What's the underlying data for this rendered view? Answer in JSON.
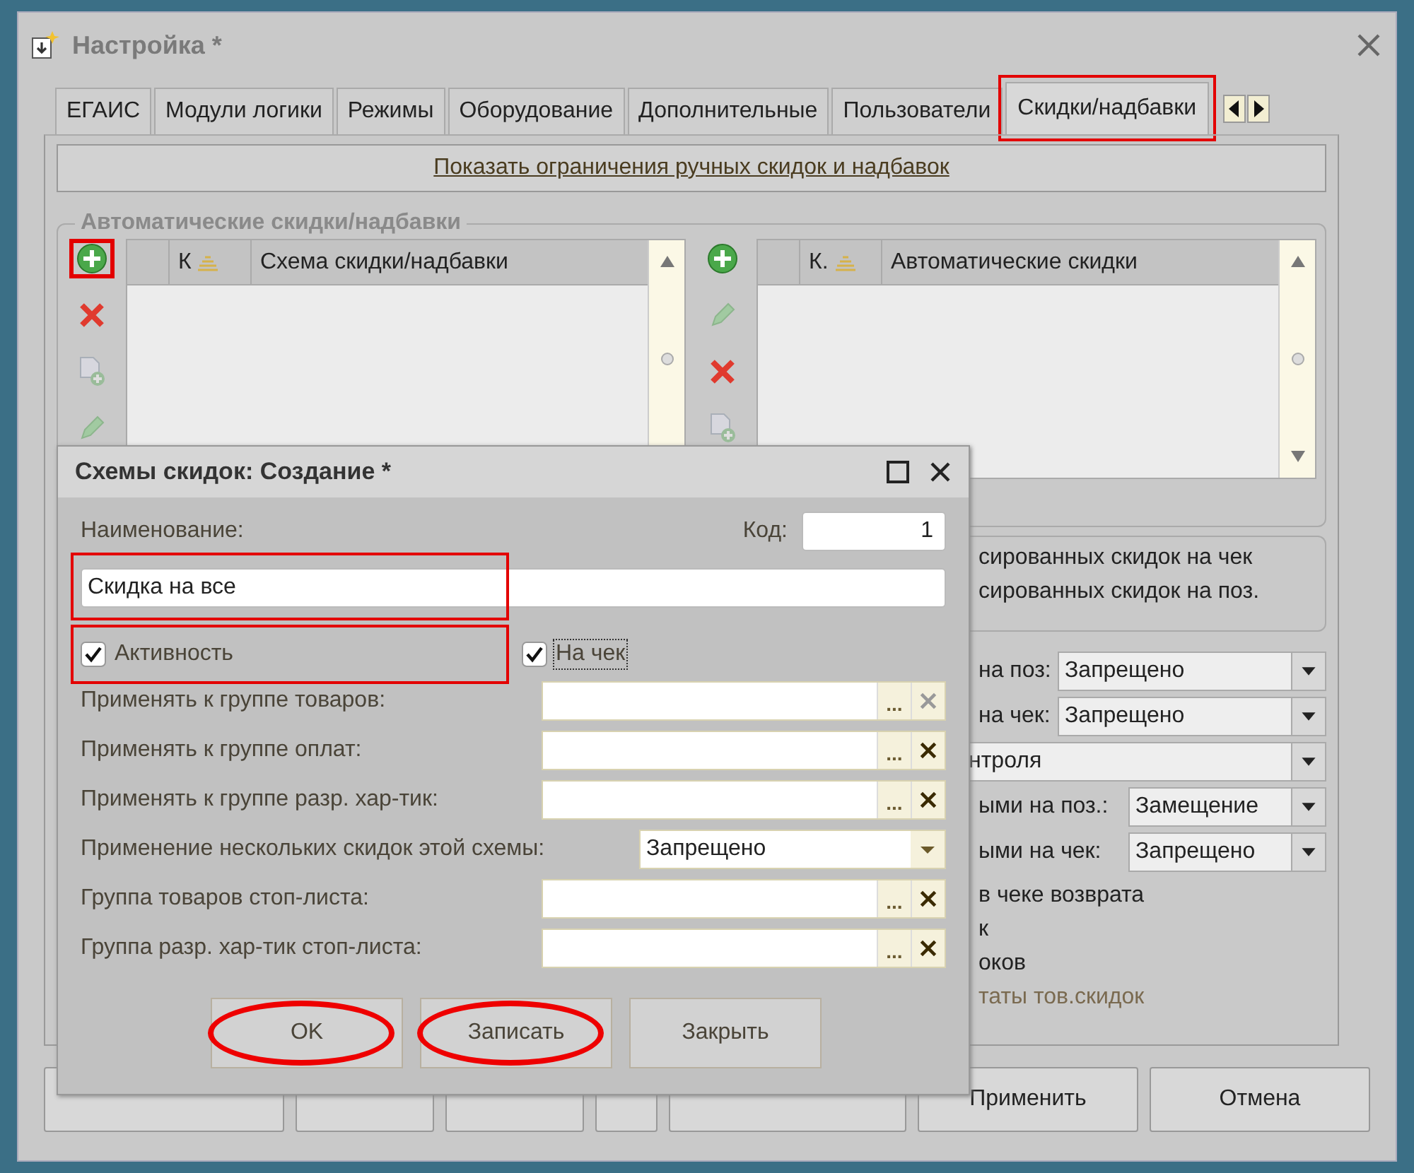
{
  "window": {
    "title": "Настройка *"
  },
  "tabs": [
    {
      "label": "ЕГАИС",
      "selected": false
    },
    {
      "label": "Модули логики",
      "selected": false
    },
    {
      "label": "Режимы",
      "selected": false
    },
    {
      "label": "Оборудование",
      "selected": false
    },
    {
      "label": "Дополнительные",
      "selected": false
    },
    {
      "label": "Пользователи",
      "selected": false
    },
    {
      "label": "Скидки/надбавки",
      "selected": true,
      "highlighted": true
    }
  ],
  "limits_link": "Показать ограничения ручных скидок и надбавок",
  "auto_group": {
    "title": "Автоматические скидки/надбавки",
    "tables": [
      {
        "toolbar": [
          {
            "kind": "add",
            "disabled": false,
            "highlighted": true
          },
          {
            "kind": "delete",
            "disabled": false
          },
          {
            "kind": "copy",
            "disabled": true
          },
          {
            "kind": "edit",
            "disabled": true
          }
        ],
        "columns": [
          "К",
          "Схема скидки/надбавки"
        ]
      },
      {
        "toolbar": [
          {
            "kind": "add",
            "disabled": false
          },
          {
            "kind": "edit",
            "disabled": true
          },
          {
            "kind": "delete",
            "disabled": false
          },
          {
            "kind": "copy",
            "disabled": true
          }
        ],
        "columns": [
          "К.",
          "Автоматические скидки"
        ]
      }
    ]
  },
  "fixed_group": {
    "lines": [
      "сированных скидок на чек",
      "сированных скидок на поз."
    ]
  },
  "settings": [
    {
      "kind": "combo",
      "label": "на поз:",
      "value": "Запрещено"
    },
    {
      "kind": "combo",
      "label": "на чек:",
      "value": "Запрещено"
    },
    {
      "kind": "combo",
      "value": "нтроля"
    },
    {
      "kind": "combo",
      "label": "ыми на поз.:",
      "value": "Замещение"
    },
    {
      "kind": "combo",
      "label": "ыми на чек:",
      "value": "Запрещено"
    },
    {
      "kind": "text",
      "label": "в чеке возврата",
      "disabled": false
    },
    {
      "kind": "text",
      "label": "к",
      "disabled": false
    },
    {
      "kind": "text",
      "label": "оков",
      "disabled": false
    },
    {
      "kind": "text",
      "label": "таты тов.скидок",
      "disabled": true
    }
  ],
  "buttons": [
    {
      "label": "Применить"
    },
    {
      "label": "Отмена"
    }
  ],
  "dialog": {
    "title": "Схемы скидок: Создание *",
    "name_label": "Наименование:",
    "code_label": "Код:",
    "code": "1",
    "name_field": {
      "value": "Скидка на все",
      "highlighted": true
    },
    "checkboxes": [
      {
        "label": "Активность",
        "checked": true,
        "highlighted": true
      },
      {
        "label": "На чек",
        "checked": true,
        "focused": true
      }
    ],
    "fields": [
      {
        "kind": "picker",
        "label": "Применять к группе товаров:",
        "picker": "...",
        "clear_disabled": true
      },
      {
        "kind": "picker",
        "label": "Применять к группе оплат:",
        "picker": "...",
        "clear_disabled": false
      },
      {
        "kind": "picker",
        "label": "Применять к группе разр. хар-тик:",
        "picker": "...",
        "clear_disabled": false
      },
      {
        "kind": "combo",
        "label": "Применение нескольких скидок этой схемы:",
        "value": "Запрещено"
      },
      {
        "kind": "picker",
        "label": "Группа товаров стоп-листа:",
        "picker": "...",
        "clear_disabled": false
      },
      {
        "kind": "picker",
        "label": "Группа разр. хар-тик стоп-листа:",
        "picker": "...",
        "clear_disabled": false
      }
    ],
    "buttons": [
      {
        "label": "OK",
        "highlighted": true
      },
      {
        "label": "Записать",
        "highlighted": true
      },
      {
        "label": "Закрыть"
      }
    ]
  }
}
